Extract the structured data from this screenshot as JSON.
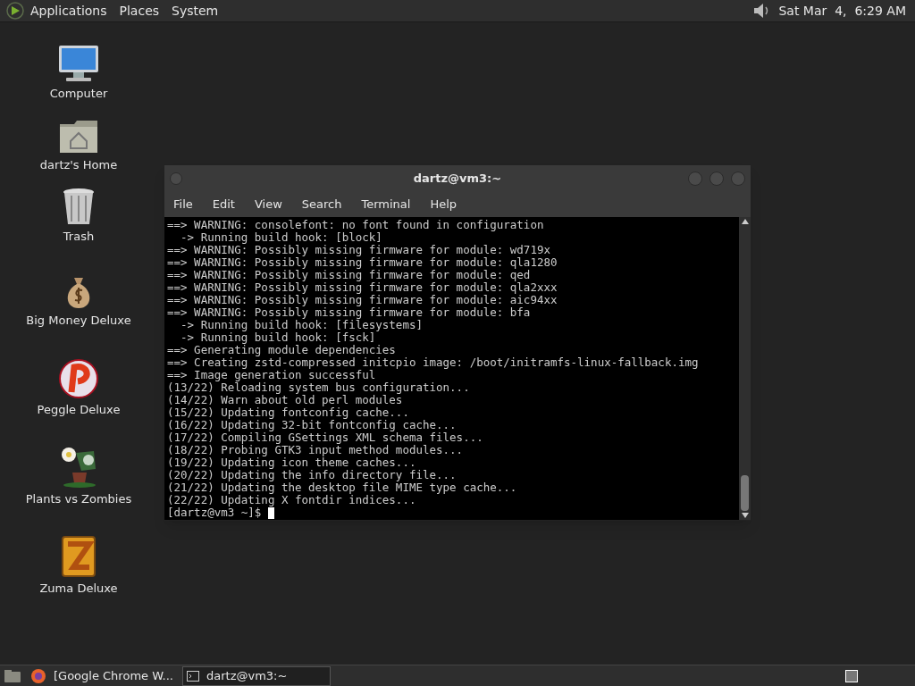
{
  "top_panel": {
    "menus": [
      "Applications",
      "Places",
      "System"
    ],
    "clock": "Sat Mar  4,  6:29 AM"
  },
  "desktop_icons": [
    {
      "kind": "computer",
      "label": "Computer"
    },
    {
      "kind": "home",
      "label": "dartz's Home"
    },
    {
      "kind": "trash",
      "label": "Trash"
    },
    {
      "kind": "moneybag",
      "label": "Big Money Deluxe"
    },
    {
      "kind": "ball",
      "label": "Peggle Deluxe"
    },
    {
      "kind": "plant",
      "label": "Plants vs Zombies"
    },
    {
      "kind": "block",
      "label": "Zuma Deluxe"
    }
  ],
  "terminal": {
    "title": "dartz@vm3:~",
    "menu": [
      "File",
      "Edit",
      "View",
      "Search",
      "Terminal",
      "Help"
    ],
    "lines": [
      "==> WARNING: consolefont: no font found in configuration",
      "  -> Running build hook: [block]",
      "==> WARNING: Possibly missing firmware for module: wd719x",
      "==> WARNING: Possibly missing firmware for module: qla1280",
      "==> WARNING: Possibly missing firmware for module: qed",
      "==> WARNING: Possibly missing firmware for module: qla2xxx",
      "==> WARNING: Possibly missing firmware for module: aic94xx",
      "==> WARNING: Possibly missing firmware for module: bfa",
      "  -> Running build hook: [filesystems]",
      "  -> Running build hook: [fsck]",
      "==> Generating module dependencies",
      "==> Creating zstd-compressed initcpio image: /boot/initramfs-linux-fallback.img",
      "==> Image generation successful",
      "(13/22) Reloading system bus configuration...",
      "(14/22) Warn about old perl modules",
      "(15/22) Updating fontconfig cache...",
      "(16/22) Updating 32-bit fontconfig cache...",
      "(17/22) Compiling GSettings XML schema files...",
      "(18/22) Probing GTK3 input method modules...",
      "(19/22) Updating icon theme caches...",
      "(20/22) Updating the info directory file...",
      "(21/22) Updating the desktop file MIME type cache...",
      "(22/22) Updating X fontdir indices..."
    ],
    "prompt": "[dartz@vm3 ~]$ "
  },
  "taskbar": [
    {
      "kind": "browser",
      "label": "[Google Chrome W...",
      "selected": false
    },
    {
      "kind": "terminal",
      "label": "dartz@vm3:~",
      "selected": true
    }
  ]
}
